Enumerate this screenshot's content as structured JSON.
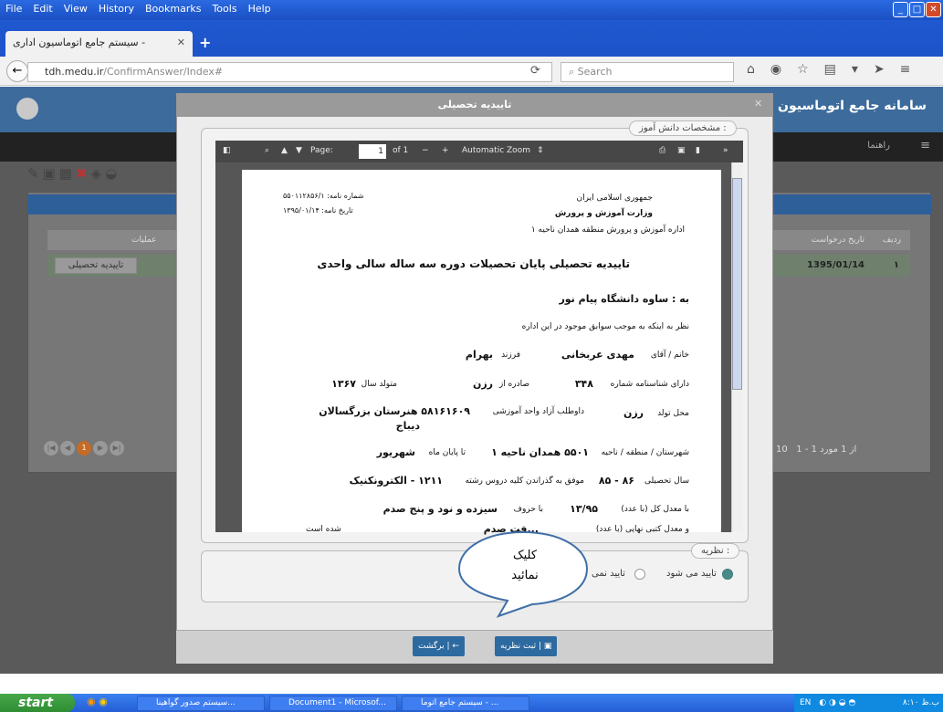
{
  "menubar": {
    "items": [
      "File",
      "Edit",
      "View",
      "History",
      "Bookmarks",
      "Tools",
      "Help"
    ]
  },
  "browser": {
    "tab_title": "سیستم جامع اتوماسیون اداری -",
    "url_host": "tdh.medu.ir",
    "url_path": "/ConfirmAnswer/Index#",
    "search_placeholder": "Search"
  },
  "app": {
    "brand": "سامانه جامع اتوماسیون اد",
    "help": "راهنما",
    "columns": {
      "row_no": "ردیف",
      "request_date": "تاریخ درخواست",
      "actions": "عملیات"
    },
    "row": {
      "number": "۱",
      "date": "1395/01/14",
      "action": "تاییدیه تحصیلی"
    },
    "pager": {
      "page": "1",
      "per_page": "10",
      "info": "1 - 1 از 1 مورد"
    }
  },
  "modal": {
    "title": "تاییدیه تحصیلی",
    "section1": "مشخصات دانش آموز :",
    "section2": "نظریه :",
    "opt_approve": "تایید می شود",
    "opt_reject": "تایید نمی",
    "submit": "ثبت نظریه",
    "back": "برگشت"
  },
  "pdf": {
    "page_label": "Page:",
    "page_num": "1",
    "page_of": "of 1",
    "zoom": "Automatic Zoom"
  },
  "doc": {
    "header_right1": "جمهوری اسلامی ایران",
    "header_right2": "وزارت آموزش و پرورش",
    "header_right3": "اداره آموزش و پرورش منطقه همدان ناحیه ۱",
    "header_left1": "شماره نامه: ۵۵۰۱۱۲۸۵۶/۱",
    "header_left2": "تاریخ نامه: ۱۳۹۵/۰۱/۱۴",
    "title": "تاییدیه تحصیلی پایان تحصیلات دوره سه ساله سالی واحدی",
    "to": "به : ساوه دانشگاه پیام نور",
    "intro": "نظر به اینکه به موجب سوابق موجود در این اداره",
    "name_label": "خانم / آقای",
    "name": "مهدی عربخانی",
    "father_label": "فرزند",
    "father": "بهرام",
    "id_label": "دارای شناسنامه شماره",
    "id": "۳۴۸",
    "issue_label": "صادره از",
    "issue": "رزن",
    "birth_label": "متولد سال",
    "birth": "۱۳۶۷",
    "place_label": "محل تولد",
    "place": "رزن",
    "unit_label": "داوطلب آزاد واحد آموزشی",
    "unit": "۵۸۱۶۱۶۰۹ هنرستان بزرگسالان",
    "unit2": "دیباج",
    "region_label": "شهرستان / منطقه / ناحیه",
    "region": "۵۵۰۱ همدان ناحیه ۱",
    "month_label": "تا پایان ماه",
    "month": "شهریور",
    "year_label": "سال تحصیلی",
    "year": "۸۶ - ۸۵",
    "field_label": "موفق به گذراندن کلیه دروس رشته",
    "field": "۱۲۱۱ - الکترونکنیک",
    "avg_label": "با معدل کل (با عدد)",
    "avg": "۱۳/۹۵",
    "avg_words_label": "با حروف",
    "avg_words": "سیزده و نود و پنج صدم",
    "final_label": "و معدل کتبی نهایی (با عدد)",
    "final_words": "...فت صدم",
    "suffix": "شده است"
  },
  "callout": {
    "line1": "کلیک",
    "line2": "نمائید"
  },
  "taskbar": {
    "start": "start",
    "tasks": [
      "سیستم صدور گواهینا...",
      "Document1 - Microsof...",
      "سیستم جامع اتوما - ..."
    ],
    "tray": "EN",
    "clock": "۸:۱۰ ب.ظ"
  }
}
